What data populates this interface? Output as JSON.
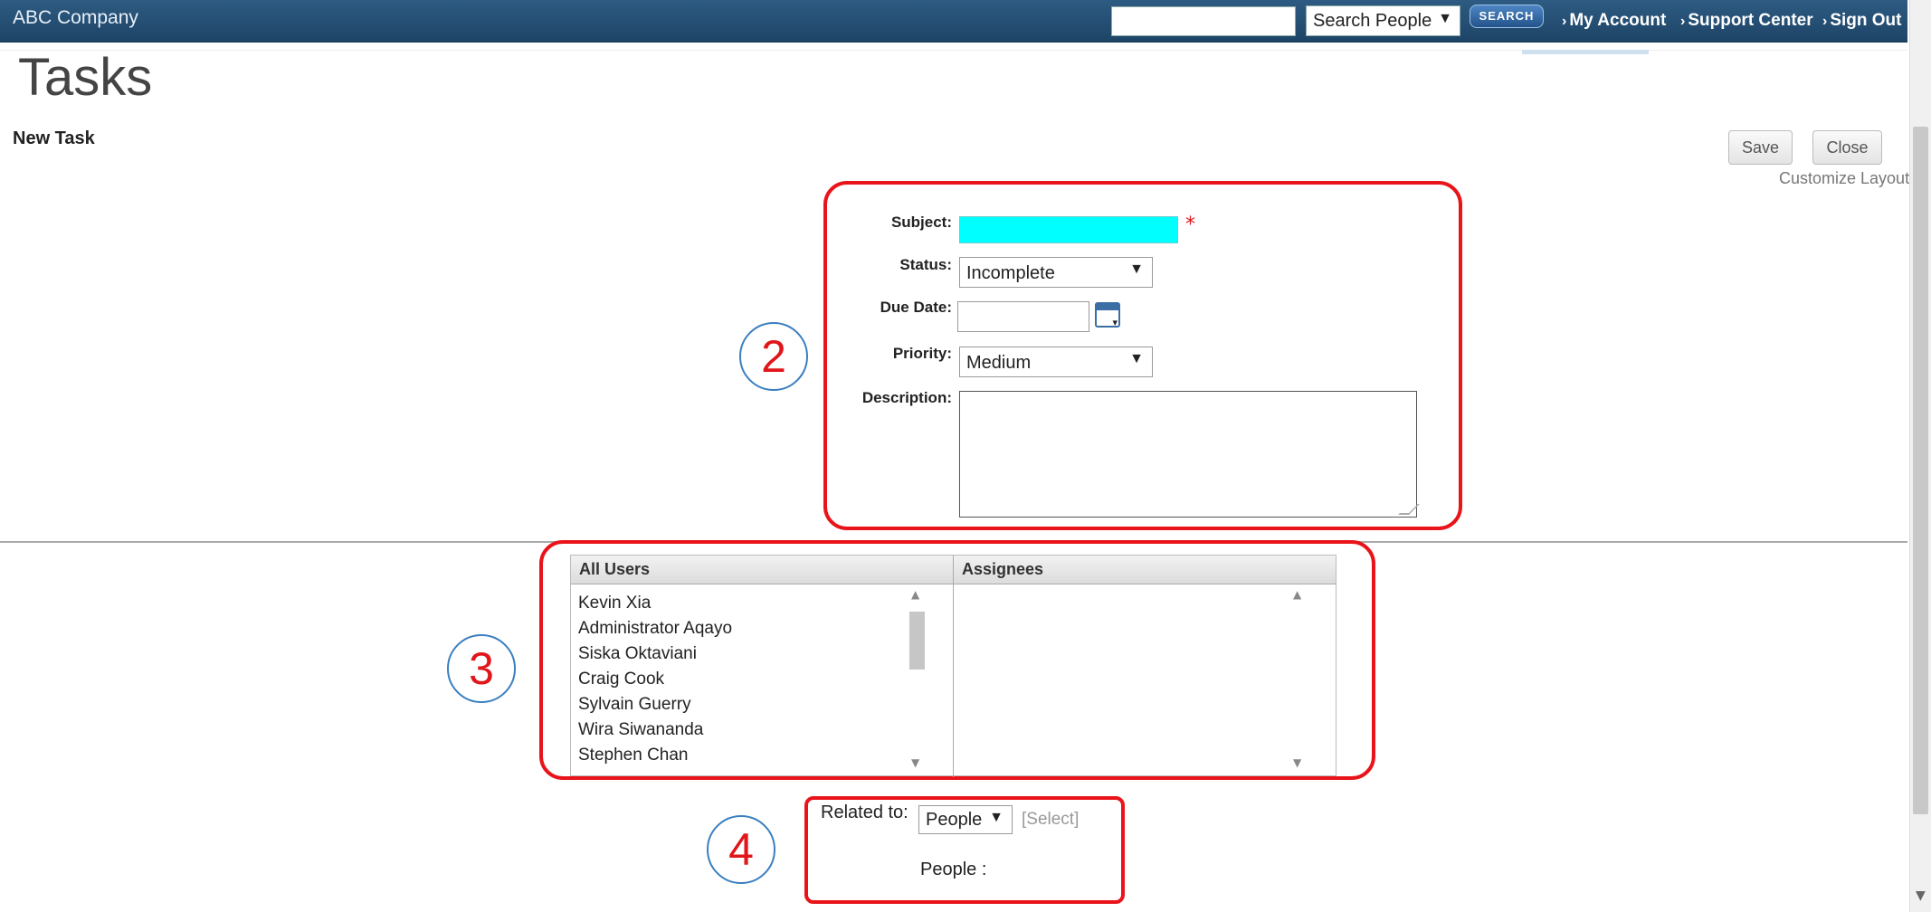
{
  "header": {
    "brand": "ABC Company",
    "search_value": "",
    "search_scope": "Search People",
    "search_button": "SEARCH",
    "links": [
      "My Account",
      "Support Center",
      "Sign Out"
    ]
  },
  "page": {
    "title": "Tasks",
    "section_title": "New Task",
    "save_label": "Save",
    "close_label": "Close",
    "customize_label": "Customize Layout"
  },
  "callouts": [
    "2",
    "3",
    "4"
  ],
  "form": {
    "subject_label": "Subject:",
    "subject_value": "",
    "required_mark": "*",
    "status_label": "Status:",
    "status_value": "Incomplete",
    "due_date_label": "Due Date:",
    "due_date_value": "",
    "priority_label": "Priority:",
    "priority_value": "Medium",
    "description_label": "Description:",
    "description_value": ""
  },
  "assignment": {
    "all_users_header": "All Users",
    "assignees_header": "Assignees",
    "all_users": [
      "Kevin Xia",
      "Administrator Aqayo",
      "Siska Oktaviani",
      "Craig Cook",
      "Sylvain Guerry",
      "Wira Siwananda",
      "Stephen Chan"
    ],
    "assignees": []
  },
  "related": {
    "label": "Related to:",
    "value": "People",
    "select_link": "[Select]",
    "people_label": "People :"
  }
}
